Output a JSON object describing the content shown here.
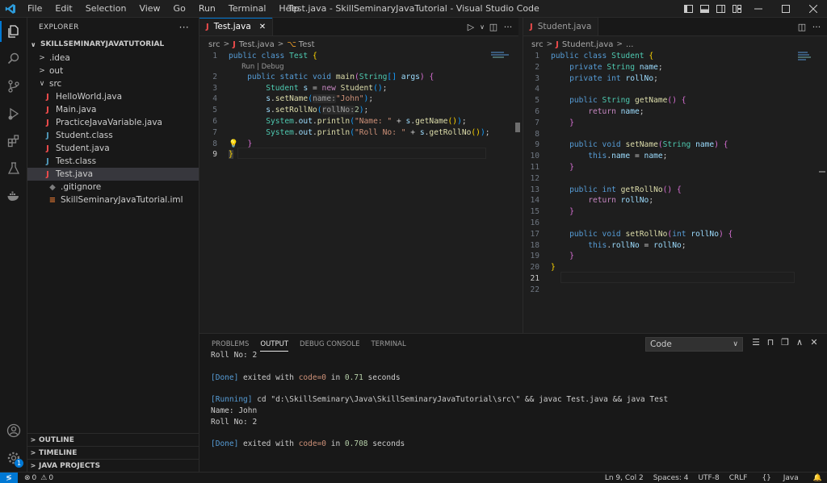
{
  "window": {
    "title": "Test.java - SkillSeminaryJavaTutorial - Visual Studio Code",
    "menu": [
      "File",
      "Edit",
      "Selection",
      "View",
      "Go",
      "Run",
      "Terminal",
      "Help"
    ]
  },
  "activity_bar": {
    "items": [
      "explorer-icon",
      "search-icon",
      "source-control-icon",
      "run-debug-icon",
      "extensions-icon",
      "testing-icon",
      "docker-icon"
    ],
    "accounts_badge": "1"
  },
  "sidebar": {
    "header": "EXPLORER",
    "project": "SKILLSEMINARYJAVATUTORIAL",
    "tree": [
      {
        "label": ".idea",
        "type": "folder",
        "depth": 1,
        "expanded": false
      },
      {
        "label": "out",
        "type": "folder",
        "depth": 1,
        "expanded": false
      },
      {
        "label": "src",
        "type": "folder",
        "depth": 1,
        "expanded": true
      },
      {
        "label": "HelloWorld.java",
        "type": "java",
        "depth": 2
      },
      {
        "label": "Main.java",
        "type": "java",
        "depth": 2
      },
      {
        "label": "PracticeJavaVariable.java",
        "type": "java",
        "depth": 2
      },
      {
        "label": "Student.class",
        "type": "class",
        "depth": 2
      },
      {
        "label": "Student.java",
        "type": "java",
        "depth": 2
      },
      {
        "label": "Test.class",
        "type": "class",
        "depth": 2
      },
      {
        "label": "Test.java",
        "type": "java",
        "depth": 2,
        "selected": true
      },
      {
        "label": ".gitignore",
        "type": "git",
        "depth": 1
      },
      {
        "label": "SkillSeminaryJavaTutorial.iml",
        "type": "iml",
        "depth": 1
      }
    ],
    "sections": [
      "OUTLINE",
      "TIMELINE",
      "JAVA PROJECTS"
    ]
  },
  "editor_left": {
    "tab": "Test.java",
    "breadcrumb": [
      "src",
      "Test.java",
      "Test"
    ],
    "codelens": "Run | Debug",
    "line_numbers": [
      "1",
      "2",
      "3",
      "4",
      "5",
      "6",
      "7",
      "8",
      "9"
    ],
    "current_line": "9"
  },
  "editor_right": {
    "tab": "Student.java",
    "breadcrumb": [
      "src",
      "Student.java",
      "..."
    ],
    "line_numbers": [
      "1",
      "2",
      "3",
      "4",
      "5",
      "6",
      "7",
      "8",
      "9",
      "10",
      "11",
      "12",
      "13",
      "14",
      "15",
      "16",
      "17",
      "18",
      "19",
      "20",
      "21",
      "22"
    ],
    "current_line": "21"
  },
  "panel": {
    "tabs": [
      "PROBLEMS",
      "OUTPUT",
      "DEBUG CONSOLE",
      "TERMINAL"
    ],
    "active_tab": "OUTPUT",
    "channel": "Code",
    "output": {
      "l1": "Roll No: 2",
      "done1_tag": "[Done]",
      "done1_a": " exited with ",
      "done1_code": "code=0",
      "done1_b": " in ",
      "done1_time": "0.71",
      "done1_c": " seconds",
      "run_tag": "[Running]",
      "run_cmd": " cd \"d:\\SkillSeminary\\Java\\SkillSeminaryJavaTutorial\\src\\\" && javac Test.java && java Test",
      "l4": "Name: John",
      "l5": "Roll No: 2",
      "done2_tag": "[Done]",
      "done2_a": " exited with ",
      "done2_code": "code=0",
      "done2_b": " in ",
      "done2_time": "0.708",
      "done2_c": " seconds"
    }
  },
  "status": {
    "errors": "0",
    "warnings": "0",
    "position": "Ln 9, Col 2",
    "spaces": "Spaces: 4",
    "encoding": "UTF-8",
    "eol": "CRLF",
    "language": "Java"
  }
}
